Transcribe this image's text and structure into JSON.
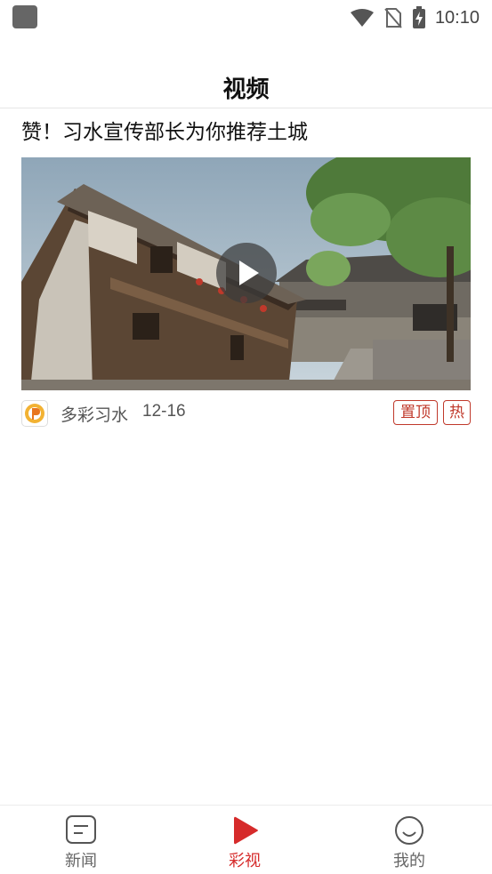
{
  "status_bar": {
    "time": "10:10",
    "icons": [
      "app-notification-icon",
      "wifi-icon",
      "no-sim-icon",
      "battery-charging-icon"
    ]
  },
  "header": {
    "title": "视频"
  },
  "video": {
    "title": "赞！习水宣传部长为你推荐土城",
    "thumbnail_icon": "historic-wooden-building-thumbnail",
    "play_icon": "play-icon",
    "source": "多彩习水",
    "date": "12-16",
    "tags": [
      "置顶",
      "热"
    ]
  },
  "bottom_nav": {
    "items": [
      {
        "label": "新闻",
        "icon": "news-icon",
        "active": false
      },
      {
        "label": "彩视",
        "icon": "video-play-icon",
        "active": true
      },
      {
        "label": "我的",
        "icon": "smiley-profile-icon",
        "active": false
      }
    ]
  },
  "colors": {
    "accent": "#d62b2b",
    "tag": "#c0392b"
  }
}
